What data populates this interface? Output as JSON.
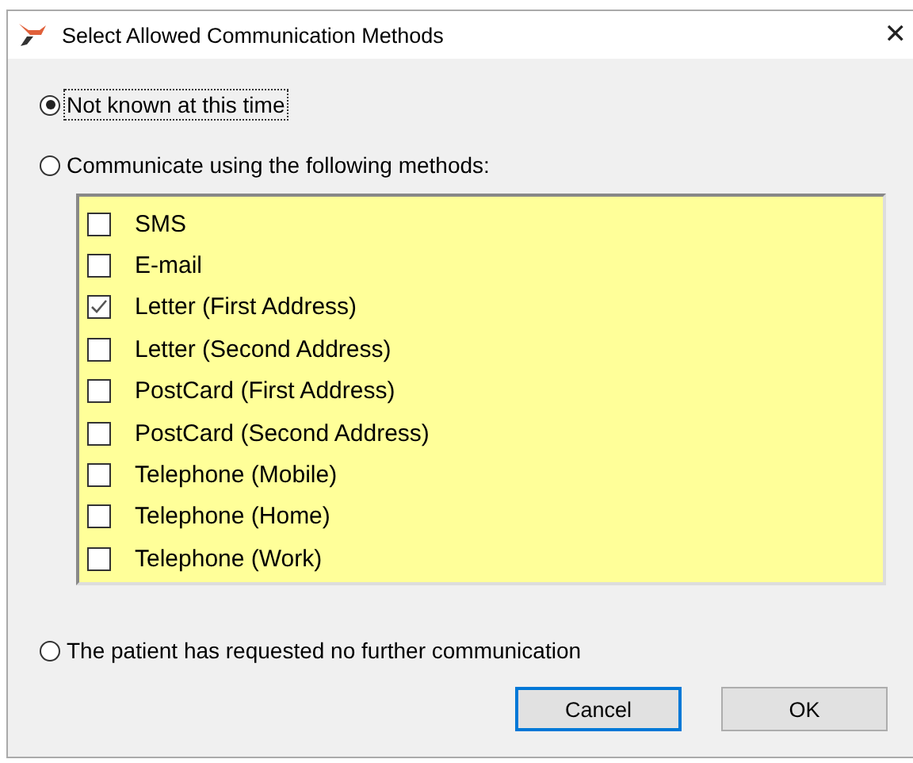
{
  "window": {
    "title": "Select Allowed Communication Methods",
    "close": "✕"
  },
  "options": [
    {
      "label": "Not known at this time",
      "selected": true,
      "focused": true
    },
    {
      "label": "Communicate using the following methods:",
      "selected": false,
      "focused": false
    }
  ],
  "methods": [
    {
      "label": "SMS",
      "checked": false
    },
    {
      "label": "E-mail",
      "checked": false
    },
    {
      "label": "Letter (First Address)",
      "checked": true
    },
    {
      "label": "Letter (Second Address)",
      "checked": false
    },
    {
      "label": "PostCard (First Address)",
      "checked": false
    },
    {
      "label": "PostCard (Second Address)",
      "checked": false
    },
    {
      "label": "Telephone (Mobile)",
      "checked": false
    },
    {
      "label": "Telephone (Home)",
      "checked": false
    },
    {
      "label": "Telephone (Work)",
      "checked": false
    }
  ],
  "final_option": {
    "label": "The patient has requested no further communication",
    "selected": false,
    "focused": false
  },
  "buttons": [
    {
      "label": "Cancel",
      "default": true
    },
    {
      "label": "OK",
      "default": false
    }
  ]
}
